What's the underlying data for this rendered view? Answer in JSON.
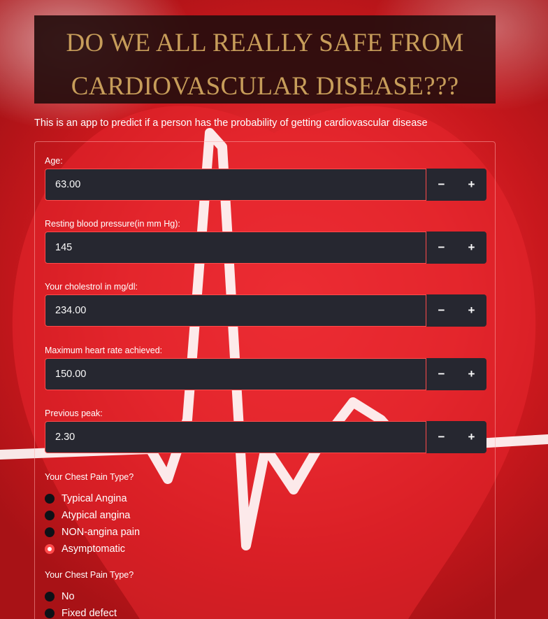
{
  "header": {
    "title_line1": "DO WE ALL REALLY SAFE FROM",
    "title_line2": "CARDIOVASCULAR DISEASE???",
    "subtitle": "This is an app to predict if a person has the probability of getting cardiovascular disease"
  },
  "fields": [
    {
      "label": "Age:",
      "value": "63.00",
      "minus": "−",
      "plus": "+"
    },
    {
      "label": "Resting blood pressure(in mm Hg):",
      "value": "145",
      "minus": "−",
      "plus": "+"
    },
    {
      "label": "Your cholestrol in mg/dl:",
      "value": "234.00",
      "minus": "−",
      "plus": "+"
    },
    {
      "label": "Maximum heart rate achieved:",
      "value": "150.00",
      "minus": "−",
      "plus": "+"
    },
    {
      "label": "Previous peak:",
      "value": "2.30",
      "minus": "−",
      "plus": "+"
    }
  ],
  "chest_pain": {
    "label": "Your Chest Pain Type?",
    "options": [
      "Typical Angina",
      "Atypical angina",
      "NON-angina pain",
      "Asymptomatic"
    ],
    "selected": "Asymptomatic"
  },
  "thal": {
    "label": "Your Chest Pain Type?",
    "options": [
      "No",
      "Fixed defect"
    ]
  },
  "colors": {
    "accent": "#ff4b4b",
    "title_gold": "#c79d5a",
    "input_bg": "#262730",
    "title_bg": "#260d0d"
  }
}
